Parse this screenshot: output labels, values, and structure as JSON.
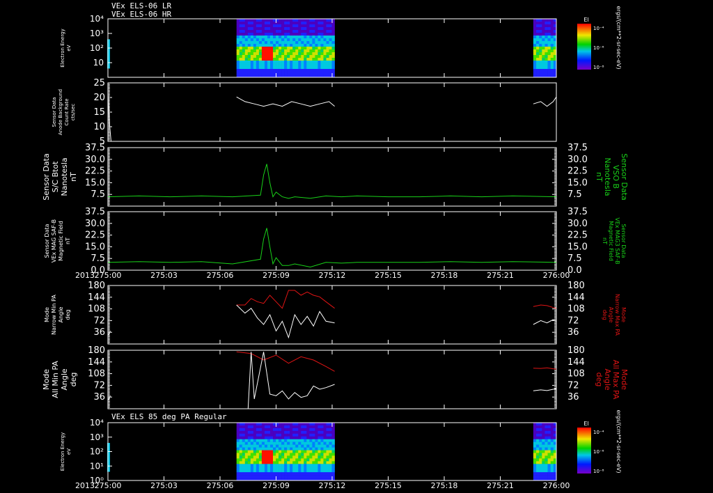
{
  "header": {
    "line1": "VEx ELS-06 LR",
    "line2": "VEx ELS-06 HR",
    "panel7_title": "VEx ELS 85 deg PA Regular"
  },
  "colors": {
    "background": "#000000",
    "axis": "#ffffff",
    "green": "#19d219",
    "red": "#e01414",
    "white": "#ffffff"
  },
  "x_axis": {
    "year": "2013",
    "ticks": [
      "275:00",
      "275:03",
      "275:06",
      "275:09",
      "275:12",
      "275:15",
      "275:18",
      "275:21",
      "276:00"
    ],
    "range_min": [
      0,
      1440
    ]
  },
  "chart_data": [
    {
      "type": "heatmap",
      "ylabel": [
        "Electron Energy",
        "eV"
      ],
      "yscale": "log",
      "ylim": [
        1,
        10000
      ],
      "ytick_labels": [
        "10",
        "10²",
        "10³",
        "10⁴"
      ],
      "data_intervals_min": [
        [
          413,
          728
        ],
        [
          1366,
          1440
        ]
      ],
      "colorbar": {
        "label": "El",
        "unit": "ergs/(cm**2-sr-sec-eV)",
        "tick_labels": [
          "10⁻⁴",
          "10⁻⁶",
          "10⁻⁸"
        ]
      }
    },
    {
      "type": "line",
      "ylabel": [
        "Sensor Data",
        "Anode Background",
        "Count Rate",
        "cts/sec"
      ],
      "ylim": [
        0,
        25
      ],
      "ytick_labels": [
        "5",
        "10",
        "15",
        "20",
        "25"
      ],
      "series": [
        {
          "color": "white",
          "segments": [
            {
              "x": [
                0,
                2,
                4,
                6,
                8,
                10
              ],
              "y": [
                21,
                15,
                10,
                6,
                3,
                0
              ]
            },
            {
              "x": [
                413,
                440,
                470,
                500,
                530,
                560,
                590,
                620,
                650,
                680,
                710,
                728
              ],
              "y": [
                19,
                17,
                16,
                15,
                16,
                15,
                17,
                16,
                15,
                16,
                17,
                15
              ]
            },
            {
              "x": [
                1366,
                1390,
                1410,
                1430,
                1440
              ],
              "y": [
                16,
                17,
                15,
                17,
                19
              ]
            }
          ]
        }
      ]
    },
    {
      "type": "line",
      "ylabel": [
        "Sensor Data",
        "S/C Btot",
        "Nanotesla",
        "nT"
      ],
      "rlabel": [
        "Sensor Data",
        "VSO B",
        "Nanotesla",
        "nT"
      ],
      "ylim": [
        0,
        37.5
      ],
      "ytick_labels": [
        "7.5",
        "15.0",
        "22.5",
        "30.0",
        "37.5"
      ],
      "series": [
        {
          "color": "green",
          "x": [
            0,
            100,
            200,
            300,
            400,
            490,
            500,
            510,
            520,
            530,
            540,
            560,
            580,
            600,
            650,
            700,
            750,
            800,
            900,
            1000,
            1100,
            1200,
            1300,
            1440
          ],
          "y": [
            6,
            6.5,
            6,
            6.5,
            6,
            7,
            20,
            27,
            15,
            6,
            9,
            6,
            5,
            6,
            5,
            6.5,
            6,
            6.5,
            6,
            6,
            6.5,
            6,
            6.5,
            6
          ]
        }
      ]
    },
    {
      "type": "line",
      "ylabel": [
        "Sensor Data",
        "VEx MAG SAF-B",
        "Magnetic Field",
        "nT"
      ],
      "rlabel": [
        "Sensor Data",
        "VEx MAG3 SAF-B",
        "Magnetic Field",
        "nT"
      ],
      "ylim": [
        0,
        37.5
      ],
      "ytick_labels": [
        "0.0",
        "7.5",
        "15.0",
        "22.5",
        "30.0",
        "37.5"
      ],
      "series": [
        {
          "color": "green",
          "x": [
            0,
            100,
            200,
            300,
            400,
            490,
            500,
            510,
            520,
            530,
            540,
            560,
            580,
            600,
            650,
            700,
            750,
            800,
            900,
            1000,
            1100,
            1200,
            1300,
            1440
          ],
          "y": [
            5,
            5.5,
            5,
            5.5,
            4,
            7,
            20,
            27,
            15,
            4,
            8,
            3,
            3,
            4,
            2,
            5,
            4.5,
            5,
            5,
            5,
            5.5,
            5,
            5.5,
            5
          ]
        }
      ]
    },
    {
      "type": "line",
      "ylabel": [
        "Mode",
        "Narrow Min PA",
        "Angle",
        "deg"
      ],
      "rlabel": [
        "Mode",
        "Narrow Max PA",
        "Angle",
        "deg"
      ],
      "ylim": [
        0,
        180
      ],
      "ytick_labels": [
        "36",
        "72",
        "108",
        "144",
        "180"
      ],
      "series": [
        {
          "color": "red",
          "segments": [
            {
              "x": [
                413,
                440,
                460,
                480,
                500,
                520,
                540,
                560,
                580,
                600,
                620,
                640,
                660,
                680,
                700,
                728
              ],
              "y": [
                120,
                120,
                140,
                130,
                125,
                150,
                130,
                110,
                165,
                165,
                150,
                160,
                150,
                145,
                130,
                110
              ]
            },
            {
              "x": [
                1366,
                1390,
                1410,
                1430,
                1440
              ],
              "y": [
                115,
                120,
                118,
                112,
                110
              ]
            }
          ]
        },
        {
          "color": "white",
          "segments": [
            {
              "x": [
                0,
                8
              ],
              "y": [
                25,
                40
              ]
            },
            {
              "x": [
                413,
                440,
                460,
                480,
                500,
                520,
                540,
                560,
                580,
                600,
                620,
                640,
                660,
                680,
                700,
                728
              ],
              "y": [
                120,
                95,
                110,
                80,
                60,
                90,
                40,
                70,
                20,
                90,
                60,
                85,
                55,
                100,
                70,
                65
              ]
            },
            {
              "x": [
                1366,
                1390,
                1410,
                1430,
                1440
              ],
              "y": [
                60,
                72,
                65,
                75,
                70
              ]
            }
          ]
        }
      ]
    },
    {
      "type": "line",
      "ylabel": [
        "Mode",
        "All Min PA",
        "Angle",
        "deg"
      ],
      "rlabel": [
        "Mode",
        "All Max PA",
        "Angle",
        "deg"
      ],
      "ylim": [
        0,
        180
      ],
      "ytick_labels": [
        "36",
        "72",
        "108",
        "144",
        "180"
      ],
      "series": [
        {
          "color": "red",
          "segments": [
            {
              "x": [
                413,
                460,
                500,
                540,
                580,
                620,
                660,
                700,
                728
              ],
              "y": [
                175,
                170,
                150,
                165,
                140,
                160,
                150,
                130,
                115
              ]
            },
            {
              "x": [
                1366,
                1390,
                1410,
                1430,
                1440
              ],
              "y": [
                125,
                124,
                126,
                123,
                122
              ]
            }
          ]
        },
        {
          "color": "white",
          "segments": [
            {
              "x": [
                0,
                8
              ],
              "y": [
                25,
                40
              ]
            },
            {
              "x": [
                413,
                450,
                460,
                470,
                500,
                520,
                540,
                560,
                580,
                600,
                620,
                640,
                660,
                680,
                700,
                728
              ],
              "y": [
                0,
                0,
                175,
                30,
                175,
                45,
                40,
                55,
                30,
                50,
                35,
                40,
                70,
                60,
                65,
                75
              ]
            },
            {
              "x": [
                1366,
                1390,
                1410,
                1430,
                1440
              ],
              "y": [
                55,
                58,
                56,
                60,
                62
              ]
            }
          ]
        }
      ]
    },
    {
      "type": "heatmap",
      "title": "VEx ELS 85 deg PA Regular",
      "ylabel": [
        "Electron Energy",
        "eV"
      ],
      "yscale": "log",
      "ylim": [
        1,
        10000
      ],
      "ytick_labels": [
        "10⁰",
        "10¹",
        "10²",
        "10³",
        "10⁴"
      ],
      "data_intervals_min": [
        [
          413,
          728
        ],
        [
          1366,
          1440
        ]
      ],
      "colorbar": {
        "label": "El",
        "unit": "ergs/(cm**2-sr-sec-eV)",
        "tick_labels": [
          "10⁻⁴",
          "10⁻⁶",
          "10⁻⁸"
        ]
      }
    }
  ]
}
